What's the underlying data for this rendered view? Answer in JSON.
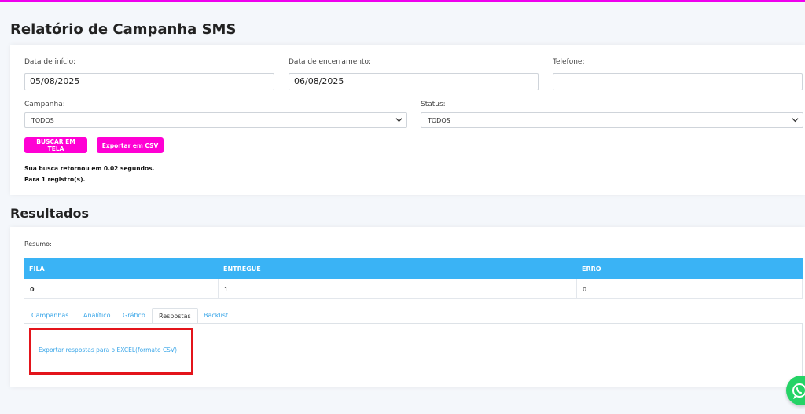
{
  "header": {
    "title": "Relatório de Campanha SMS"
  },
  "filters": {
    "start_date": {
      "label": "Data de início:",
      "value": "05/08/2025"
    },
    "end_date": {
      "label": "Data de encerramento:",
      "value": "06/08/2025"
    },
    "phone": {
      "label": "Telefone:",
      "value": ""
    },
    "campaign": {
      "label": "Campanha:",
      "selected": "TODOS"
    },
    "status": {
      "label": "Status:",
      "selected": "TODOS"
    },
    "search_button": "BUSCAR EM TELA",
    "export_button": "Exportar em CSV",
    "info_time": "Sua busca retornou em 0.02 segundos.",
    "info_count": "Para 1 registro(s)."
  },
  "results": {
    "title": "Resultados",
    "summary_label": "Resumo:",
    "columns": [
      "FILA",
      "ENTREGUE",
      "ERRO"
    ],
    "row": [
      "0",
      "1",
      "0"
    ],
    "tabs": [
      "Campanhas",
      "Analítico",
      "Gráfico",
      "Respostas",
      "Backlist"
    ],
    "active_tab": "Respostas",
    "export_link": "Exportar respostas para o EXCEL(formato CSV)"
  },
  "colors": {
    "accent": "#ff00d4",
    "table_header": "#3ab3f5",
    "link": "#3aa6e8",
    "highlight": "#e3141b",
    "whatsapp": "#25d366"
  },
  "icons": {
    "select_arrow": "chevron-down-icon",
    "chat": "whatsapp-icon"
  }
}
